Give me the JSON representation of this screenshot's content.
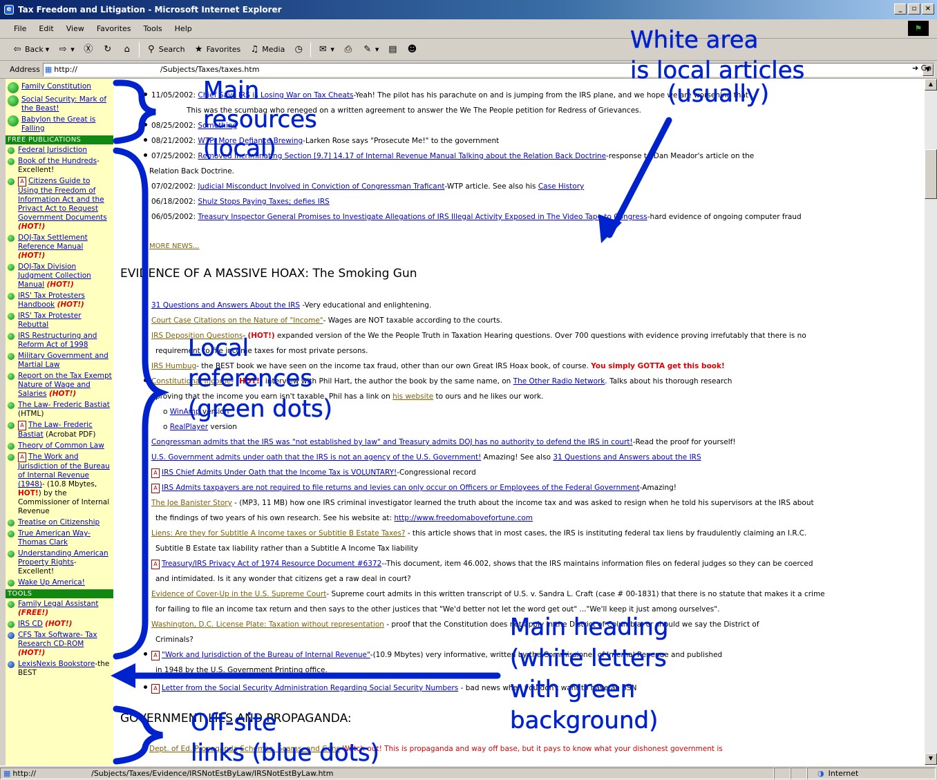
{
  "window": {
    "title": "Tax Freedom and Litigation - Microsoft Internet Explorer",
    "buttons": [
      "_",
      "▫",
      "×"
    ]
  },
  "menu": [
    "File",
    "Edit",
    "View",
    "Favorites",
    "Tools",
    "Help"
  ],
  "toolbar": {
    "back": "Back",
    "search": "Search",
    "favorites": "Favorites",
    "media": "Media"
  },
  "address": {
    "label": "Address",
    "url_prefix": "http://",
    "url_path": "/Subjects/Taxes/taxes.htm",
    "go": "Go"
  },
  "sidebar": {
    "top_items": [
      {
        "label": "Family Constitution"
      },
      {
        "label": "Social Security: Mark of the Beast!"
      },
      {
        "label": "Babylon the Great is Falling"
      }
    ],
    "free_publications_heading": "FREE PUBLICATIONS",
    "free_publications": [
      {
        "label": "Federal Jurisdiction"
      },
      {
        "label": "Book of the Hundreds",
        "suffix": "-Excellent!"
      },
      {
        "label": "Citizens Guide to Using the Freedom of Information Act and the Privact Act to Request Government Documents",
        "hot": "(HOT!)"
      },
      {
        "label": "DOJ-Tax Settlement Reference Manual",
        "hot": "(HOT!)"
      },
      {
        "label": "DOJ-Tax Division Judgment Collection Manual",
        "hot": "(HOT!)"
      },
      {
        "label": "IRS' Tax Protesters Handbook",
        "hot": "(HOT!)"
      },
      {
        "label": "IRS' Tax Protester Rebuttal"
      },
      {
        "label": "IRS Restructuring and Reform Act of 1998"
      },
      {
        "label": "Military Government and Martial Law"
      },
      {
        "label": "Report on the Tax Exempt Nature of Wage and Salaries",
        "hot": "(HOT!)"
      },
      {
        "label": "The Law- Frederic Bastiat",
        "suffix": " (HTML)"
      },
      {
        "label": "The Law- Frederic Bastiat",
        "suffix": " (Acrobat PDF)"
      },
      {
        "label": "Theory of Common Law"
      },
      {
        "label": "The Work and Jurisdiction of the Bureau of Internal Revenue (1948)",
        "suffix": "- (10.8 Mbytes, ",
        "hot": "HOT!",
        "suffix2": ") by the Commissioner of Internal Revenue"
      },
      {
        "label": "Treatise on Citizenship"
      },
      {
        "label": "True American Way- Thomas Clark"
      },
      {
        "label": "Understanding American Property Rights",
        "suffix": "-Excellent!"
      },
      {
        "label": "Wake Up America!"
      }
    ],
    "tools_heading": "TOOLS",
    "tools": [
      {
        "label": "Family Legal Assistant",
        "hot": "(FREE!)"
      },
      {
        "label": "IRS CD",
        "hot": "(HOT!)"
      },
      {
        "label": "CFS Tax Software- Tax Research CD-ROM",
        "hot": "(HOT!)"
      },
      {
        "label": "LexisNexis Bookstore",
        "suffix": "-the BEST"
      }
    ]
  },
  "news": [
    {
      "date": "11/05/2002:",
      "link": "Chief Says IRS is Losing War on Tax Cheats",
      "text": "-Yeah! The pilot has his parachute on and is jumping from the IRS plane, and we hope we are worsening that"
    },
    {
      "date": "",
      "link": "",
      "text": "This was the scumbag who reneged on a written agreement to answer the We The People petition for Redress of Grievances."
    },
    {
      "date": "08/25/2002:",
      "link": "Something",
      "text": ""
    },
    {
      "date": "08/21/2002:",
      "link": "WTP: More Defiance Brewing",
      "text": "-Larken Rose says \"Prosecute Me!\" to the government"
    },
    {
      "date": "07/25/2002:",
      "link": "Removed Incriminating Section [9.7] 14.17 of Internal Revenue Manual Talking about the Relation Back Doctrine",
      "text": "-response to Dan Meador's article on the"
    },
    {
      "date": "",
      "link": "",
      "text": "Relation Back Doctrine."
    },
    {
      "date": "07/02/2002:",
      "link": "Judicial Misconduct Involved in Conviction of Congressman Traficant",
      "text": "-WTP article.  See also his ",
      "link2": "Case History"
    },
    {
      "date": "06/18/2002:",
      "link": "Shulz Stops Paying Taxes; defies IRS",
      "text": ""
    },
    {
      "date": "06/05/2002:",
      "link": "Treasury Inspector General Promises to Investigate Allegations of IRS Illegal Activity Exposed in The Video Tape to Congress",
      "text": "-hard evidence of ongoing computer fraud"
    }
  ],
  "more_news": "MORE NEWS...",
  "section1_title": "EVIDENCE OF A MASSIVE HOAX: The Smoking Gun",
  "evidence": [
    {
      "link": "31 Questions and Answers About the IRS",
      "text": " -Very educational and enlightening."
    },
    {
      "link": "Court Case Citations on the Nature of \"Income\"",
      "text": "- Wages are NOT taxable according to the courts."
    },
    {
      "link": "IRS Deposition Questions",
      "hot": "(HOT!)",
      "text": " expanded version of the We the People Truth in Taxation Hearing questions.  Over 700 questions with evidence proving irrefutably that there is no"
    },
    {
      "text": "requirement to file income taxes for most private persons."
    },
    {
      "link": "IRS Humbug",
      "text": "- the BEST book we have seen on the income tax fraud, other than our own Great IRS Hoax book, of course.",
      "red": "You simply GOTTA get this book!"
    },
    {
      "link": "Constitutional Income",
      "hot": "(HOT!)",
      "text": " interview with Phil Hart, the author the book by the same name, on ",
      "link2": "The Other Radio Network",
      "text2": ".  Talks about his thorough research"
    },
    {
      "text": "proving that the income you earn isn't taxable.  Phil has a link on ",
      "link2": "his website",
      "text2": " to ours and he likes our work."
    },
    {
      "link": "WinAmp",
      "text": " version"
    },
    {
      "link": "RealPlayer",
      "text": " version"
    },
    {
      "link": "Congressman admits that the IRS was \"not established by law\" and Treasury admits DOJ has no authority to defend the IRS in court!",
      "text": "-Read the proof for yourself!"
    },
    {
      "link": "U.S. Government admits under oath that the IRS is not an agency of the U.S. Government!",
      "text": "  Amazing!  See also ",
      "link2": "31 Questions and Answers about the IRS"
    },
    {
      "link": "IRS Chief Admits Under Oath that the Income Tax is VOLUNTARY!",
      "text": "-Congressional record"
    },
    {
      "link": "IRS Admits taxpayers are not required to file returns and levies can only occur on Officers or Employees of the Federal Government",
      "text": "-Amazing!"
    },
    {
      "link": "The Joe Banister Story",
      "text": " - (MP3, 11 MB) how one IRS criminal investigator learned the truth about the income tax and was asked to resign when he told his supervisors at the IRS about"
    },
    {
      "text": "the findings of two years of his own research.  See his website at: ",
      "link2": "http://www.freedomabovefortune.com"
    },
    {
      "link": "Liens: Are they for Subtitle A Income taxes or Subtitle B Estate Taxes?",
      "text": " - this article shows that in most cases, the IRS is instituting federal tax liens by fraudulently claiming an I.R.C."
    },
    {
      "text": "Subtitle B Estate tax liability rather than a Subtitle A Income Tax liability"
    },
    {
      "link": "Treasury/IRS Privacy Act of 1974 Resource Document #6372",
      "text": "--This document, item 46.002,  shows that the IRS maintains information files on federal judges so they can be coerced"
    },
    {
      "text": "and intimidated.  Is it any wonder that citizens get a raw deal in court?"
    },
    {
      "link": "Evidence of Cover-Up in the U.S. Supreme Court",
      "text": "- Supreme court admits in this written transcript of U.S. v. Sandra L. Craft (case # 00-1831) that there is no statute that makes it a crime"
    },
    {
      "text": "for failing to file an income tax return and then says to the other justices that \"We'd better not let the word get out\" ...\"We'll keep it just among ourselves\"."
    },
    {
      "link": "Washington, D.C. License Plate: Taxation without representation",
      "text": " - proof that the Constitution does not apply in the District of Columbia, or should we say the District of"
    },
    {
      "text": "Criminals?"
    },
    {
      "link": "\"Work and Jurisdiction of the Bureau of Internal Revenue\"",
      "text": "-(10.9 Mbytes) very informative, written by the Commissioner of Internal Revenue and published"
    },
    {
      "text": "in 1948 by the U.S. Government Printing office."
    },
    {
      "link": "Letter from the Social Security Administration Regarding Social Security Numbers",
      "text": " - bad news when you don't want to have an SSN"
    }
  ],
  "section2_title": "GOVERNMENT LIES AND PROPAGANDA:",
  "propaganda": {
    "link": "Dept. of Ed. Propaganda",
    "link_b": "Schemes, Scams, and Cons",
    "red": "-Watch out!  This is propaganda and way off base, but it pays to know what your dishonest government is"
  },
  "status": {
    "url_prefix": "http://",
    "url_path": "/Subjects/Taxes/Evidence/IRSNotEstByLaw/IRSNotEstByLaw.htm",
    "zone": "Internet"
  },
  "annotations": {
    "white_area": [
      "White area",
      "is local articles",
      "(usually)"
    ],
    "main_resources": [
      "Main",
      "resources",
      "(local)"
    ],
    "local_refs": [
      "Local",
      "references",
      "(green dots)"
    ],
    "main_heading": [
      "Main heading",
      "(white letters",
      "with green",
      "background)"
    ],
    "offsite": [
      "Off-site",
      "links (blue dots)"
    ]
  },
  "colors": {
    "accent_green": "#118811",
    "link_blue": "#0000cc",
    "annotation_blue": "#0022cc",
    "hot_red": "#e00000",
    "sidebar_bg": "#ffffc0"
  }
}
